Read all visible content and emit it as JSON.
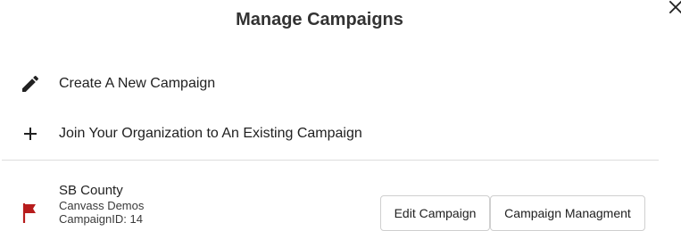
{
  "dialog": {
    "title": "Manage Campaigns"
  },
  "actions": [
    {
      "label": "Create A New Campaign",
      "icon": "pencil-icon"
    },
    {
      "label": "Join Your Organization to An Existing Campaign",
      "icon": "plus-icon"
    }
  ],
  "campaigns": [
    {
      "name": "SB County",
      "organization": "Canvass Demos",
      "id_text": "CampaignID: 14",
      "icon": "flag-icon",
      "edit_label": "Edit Campaign",
      "manage_label": "Campaign Managment"
    }
  ],
  "colors": {
    "flag": "#b71c1c",
    "divider": "#dcdcdc",
    "text": "#212121"
  }
}
